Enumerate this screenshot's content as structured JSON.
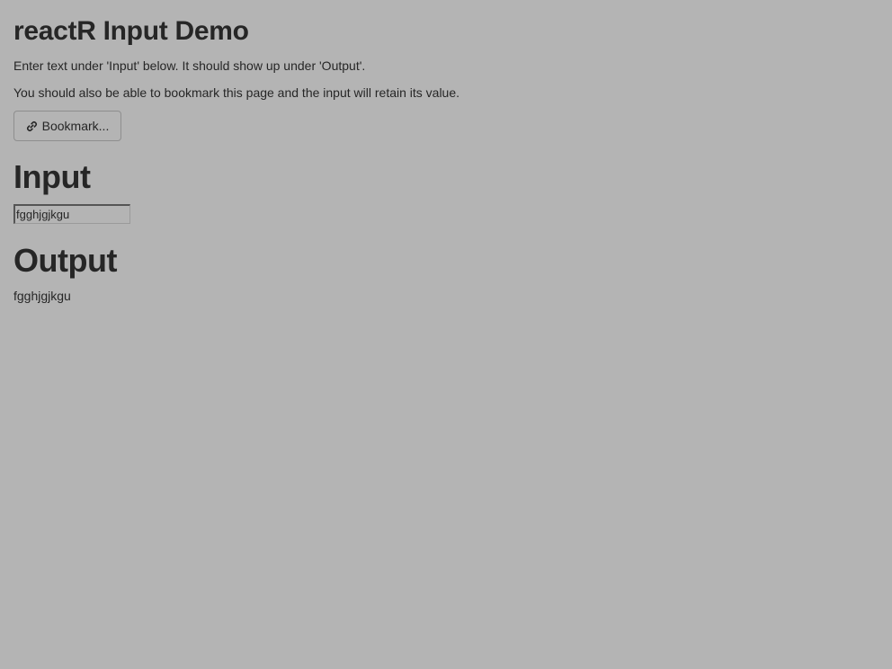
{
  "page": {
    "title": "reactR Input Demo",
    "description_1": "Enter text under 'Input' below. It should show up under 'Output'.",
    "description_2": "You should also be able to bookmark this page and the input will retain its value."
  },
  "bookmark": {
    "label": "Bookmark...",
    "icon": "link-icon"
  },
  "input_section": {
    "heading": "Input",
    "value": "fgghjgjkgu"
  },
  "output_section": {
    "heading": "Output",
    "value": "fgghjgjkgu"
  },
  "colors": {
    "background": "#b4b4b4",
    "text": "#262626",
    "button_border": "#8e8e8e"
  }
}
